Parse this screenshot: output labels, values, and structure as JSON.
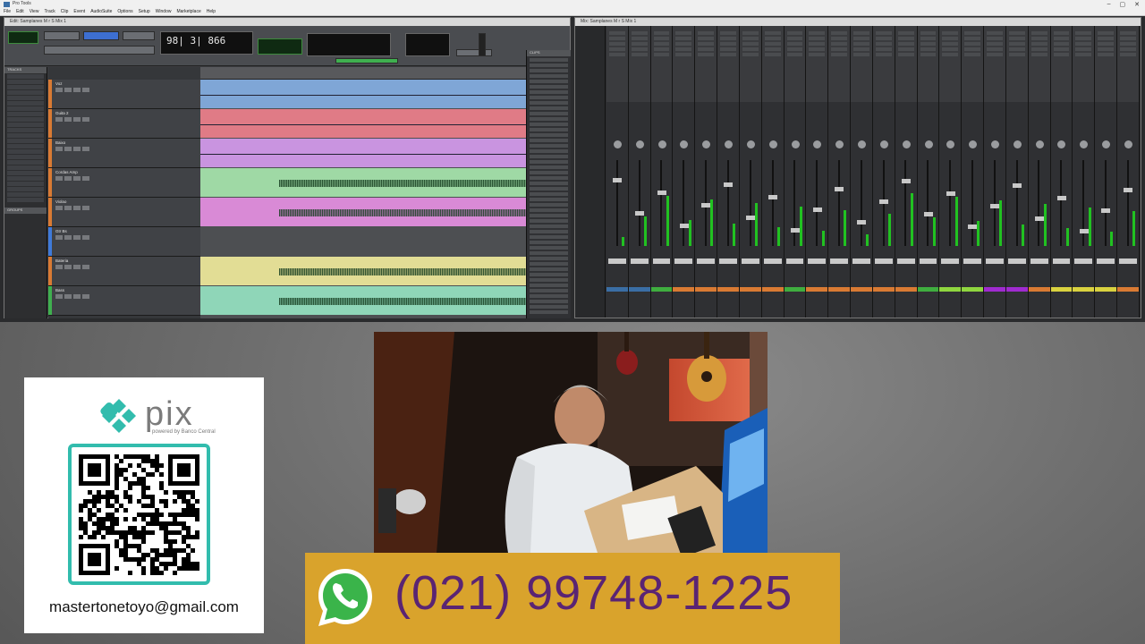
{
  "daw": {
    "app_title": "Pro Tools",
    "menu": [
      "File",
      "Edit",
      "View",
      "Track",
      "Clip",
      "Event",
      "AudioSuite",
      "Options",
      "Setup",
      "Window",
      "Marketplace",
      "Help"
    ],
    "edit_window_title": "Edit: Samplanes M r S Mix 1",
    "mix_window_title": "Mix: Samplanes M r S Mix 1",
    "counter": "98| 3| 866",
    "tracks_panel": "TRACKS",
    "groups_panel": "GROUPS",
    "clips_panel": "CLIPS",
    "edit_tracks": [
      {
        "name": "Voz",
        "color": "#d97a33"
      },
      {
        "name": "Guita 2",
        "color": "#d97a33"
      },
      {
        "name": "Baixo",
        "color": "#d97a33"
      },
      {
        "name": "Cordas Amp",
        "color": "#d97a33"
      },
      {
        "name": "Violao",
        "color": "#d97a33"
      },
      {
        "name": "Gtr Bs",
        "color": "#3f7ad9"
      },
      {
        "name": "Bateria",
        "color": "#d97a33"
      },
      {
        "name": "Bass",
        "color": "#3fb04f"
      }
    ],
    "lanes": [
      {
        "color": "#7fa6d6",
        "kind": "midi"
      },
      {
        "color": "#e07b86",
        "kind": "midi"
      },
      {
        "color": "#c994e0",
        "kind": "midi"
      },
      {
        "color": "#9fd9a5",
        "kind": "audio"
      },
      {
        "color": "#d98ad6",
        "kind": "audio"
      },
      {
        "color": "#4d4f52",
        "kind": "empty"
      },
      {
        "color": "#e2dd95",
        "kind": "audio"
      },
      {
        "color": "#8fd6b8",
        "kind": "audio"
      }
    ],
    "mixer_bus_colors": [
      "#3a6ea5",
      "#3a6ea5",
      "#3fae3f",
      "#d97a33",
      "#d97a33",
      "#d97a33",
      "#d97a33",
      "#d97a33",
      "#3fae3f",
      "#d97a33",
      "#d97a33",
      "#d97a33",
      "#d97a33",
      "#d97a33",
      "#3fae3f",
      "#8fd63f",
      "#8fd63f",
      "#a02bd0",
      "#a02bd0",
      "#d97a33",
      "#d9d23f",
      "#d9d23f",
      "#d9d23f",
      "#d97a33"
    ]
  },
  "pix": {
    "brand": "pix",
    "tagline": "powered by Banco Central",
    "email": "mastertonetoyo@gmail.com",
    "accent_color": "#32bcad"
  },
  "contact": {
    "phone": "(021) 99748-1225",
    "banner_color": "#d9a32c",
    "text_color": "#5a2473",
    "icon": "whatsapp-icon"
  }
}
